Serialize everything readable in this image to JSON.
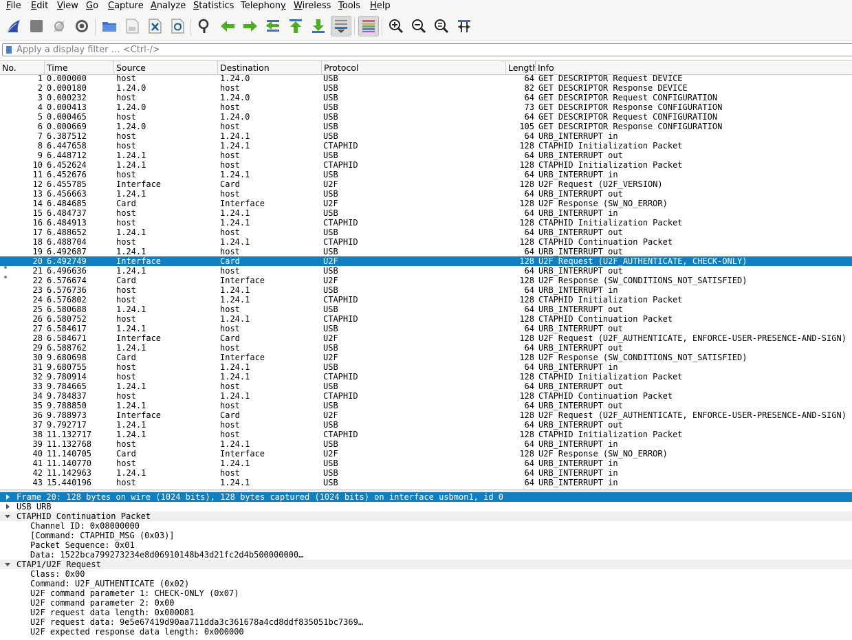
{
  "menu": [
    {
      "key": "file",
      "pre": "",
      "u": "F",
      "post": "ile"
    },
    {
      "key": "edit",
      "pre": "",
      "u": "E",
      "post": "dit"
    },
    {
      "key": "view",
      "pre": "",
      "u": "V",
      "post": "iew"
    },
    {
      "key": "go",
      "pre": "",
      "u": "G",
      "post": "o"
    },
    {
      "key": "capture",
      "pre": "",
      "u": "C",
      "post": "apture"
    },
    {
      "key": "analyze",
      "pre": "",
      "u": "A",
      "post": "nalyze"
    },
    {
      "key": "statistics",
      "pre": "",
      "u": "S",
      "post": "tatistics"
    },
    {
      "key": "telephony",
      "pre": "Telephon",
      "u": "y",
      "post": ""
    },
    {
      "key": "wireless",
      "pre": "",
      "u": "W",
      "post": "ireless"
    },
    {
      "key": "tools",
      "pre": "",
      "u": "T",
      "post": "ools"
    },
    {
      "key": "help",
      "pre": "",
      "u": "H",
      "post": "elp"
    }
  ],
  "toolbar_icons": [
    "shark-fin-icon",
    "stop-capture-icon",
    "restart-capture-icon",
    "capture-options-icon",
    "open-file-icon",
    "save-file-icon",
    "close-file-icon",
    "reload-file-icon",
    "find-packet-icon",
    "go-back-icon",
    "go-forward-icon",
    "go-to-packet-icon",
    "go-first-packet-icon",
    "go-last-packet-icon",
    "auto-scroll-icon",
    "colorize-icon",
    "zoom-in-icon",
    "zoom-out-icon",
    "zoom-normal-icon",
    "resize-columns-icon"
  ],
  "filter": {
    "placeholder": "Apply a display filter … <Ctrl-/>"
  },
  "columns": {
    "no": "No.",
    "time": "Time",
    "source": "Source",
    "destination": "Destination",
    "protocol": "Protocol",
    "length": "Length",
    "info": "Info"
  },
  "packets": [
    {
      "no": "1",
      "time": "0.000000",
      "src": "host",
      "dst": "1.24.0",
      "proto": "USB",
      "len": "64",
      "info": "GET DESCRIPTOR Request DEVICE"
    },
    {
      "no": "2",
      "time": "0.000180",
      "src": "1.24.0",
      "dst": "host",
      "proto": "USB",
      "len": "82",
      "info": "GET DESCRIPTOR Response DEVICE"
    },
    {
      "no": "3",
      "time": "0.000232",
      "src": "host",
      "dst": "1.24.0",
      "proto": "USB",
      "len": "64",
      "info": "GET DESCRIPTOR Request CONFIGURATION"
    },
    {
      "no": "4",
      "time": "0.000413",
      "src": "1.24.0",
      "dst": "host",
      "proto": "USB",
      "len": "73",
      "info": "GET DESCRIPTOR Response CONFIGURATION"
    },
    {
      "no": "5",
      "time": "0.000465",
      "src": "host",
      "dst": "1.24.0",
      "proto": "USB",
      "len": "64",
      "info": "GET DESCRIPTOR Request CONFIGURATION"
    },
    {
      "no": "6",
      "time": "0.000669",
      "src": "1.24.0",
      "dst": "host",
      "proto": "USB",
      "len": "105",
      "info": "GET DESCRIPTOR Response CONFIGURATION"
    },
    {
      "no": "7",
      "time": "6.387512",
      "src": "host",
      "dst": "1.24.1",
      "proto": "USB",
      "len": "64",
      "info": "URB_INTERRUPT in"
    },
    {
      "no": "8",
      "time": "6.447658",
      "src": "host",
      "dst": "1.24.1",
      "proto": "CTAPHID",
      "len": "128",
      "info": "CTAPHID Initialization Packet"
    },
    {
      "no": "9",
      "time": "6.448712",
      "src": "1.24.1",
      "dst": "host",
      "proto": "USB",
      "len": "64",
      "info": "URB_INTERRUPT out"
    },
    {
      "no": "10",
      "time": "6.452624",
      "src": "1.24.1",
      "dst": "host",
      "proto": "CTAPHID",
      "len": "128",
      "info": "CTAPHID Initialization Packet"
    },
    {
      "no": "11",
      "time": "6.452676",
      "src": "host",
      "dst": "1.24.1",
      "proto": "USB",
      "len": "64",
      "info": "URB_INTERRUPT in"
    },
    {
      "no": "12",
      "time": "6.455785",
      "src": "Interface",
      "dst": "Card",
      "proto": "U2F",
      "len": "128",
      "info": "U2F Request (U2F_VERSION)"
    },
    {
      "no": "13",
      "time": "6.456663",
      "src": "1.24.1",
      "dst": "host",
      "proto": "USB",
      "len": "64",
      "info": "URB_INTERRUPT out"
    },
    {
      "no": "14",
      "time": "6.484685",
      "src": "Card",
      "dst": "Interface",
      "proto": "U2F",
      "len": "128",
      "info": "U2F Response (SW_NO_ERROR)"
    },
    {
      "no": "15",
      "time": "6.484737",
      "src": "host",
      "dst": "1.24.1",
      "proto": "USB",
      "len": "64",
      "info": "URB_INTERRUPT in"
    },
    {
      "no": "16",
      "time": "6.484913",
      "src": "host",
      "dst": "1.24.1",
      "proto": "CTAPHID",
      "len": "128",
      "info": "CTAPHID Initialization Packet"
    },
    {
      "no": "17",
      "time": "6.488652",
      "src": "1.24.1",
      "dst": "host",
      "proto": "USB",
      "len": "64",
      "info": "URB_INTERRUPT out"
    },
    {
      "no": "18",
      "time": "6.488704",
      "src": "host",
      "dst": "1.24.1",
      "proto": "CTAPHID",
      "len": "128",
      "info": "CTAPHID Continuation Packet"
    },
    {
      "no": "19",
      "time": "6.492687",
      "src": "1.24.1",
      "dst": "host",
      "proto": "USB",
      "len": "64",
      "info": "URB_INTERRUPT out"
    },
    {
      "no": "20",
      "time": "6.492749",
      "src": "Interface",
      "dst": "Card",
      "proto": "U2F",
      "len": "128",
      "info": "U2F Request (U2F_AUTHENTICATE, CHECK-ONLY)",
      "selected": true
    },
    {
      "no": "21",
      "time": "6.496636",
      "src": "1.24.1",
      "dst": "host",
      "proto": "USB",
      "len": "64",
      "info": "URB_INTERRUPT out",
      "marked": true
    },
    {
      "no": "22",
      "time": "6.576674",
      "src": "Card",
      "dst": "Interface",
      "proto": "U2F",
      "len": "128",
      "info": "U2F Response (SW_CONDITIONS_NOT_SATISFIED)",
      "marked": true
    },
    {
      "no": "23",
      "time": "6.576736",
      "src": "host",
      "dst": "1.24.1",
      "proto": "USB",
      "len": "64",
      "info": "URB_INTERRUPT in"
    },
    {
      "no": "24",
      "time": "6.576802",
      "src": "host",
      "dst": "1.24.1",
      "proto": "CTAPHID",
      "len": "128",
      "info": "CTAPHID Initialization Packet"
    },
    {
      "no": "25",
      "time": "6.580688",
      "src": "1.24.1",
      "dst": "host",
      "proto": "USB",
      "len": "64",
      "info": "URB_INTERRUPT out"
    },
    {
      "no": "26",
      "time": "6.580752",
      "src": "host",
      "dst": "1.24.1",
      "proto": "CTAPHID",
      "len": "128",
      "info": "CTAPHID Continuation Packet"
    },
    {
      "no": "27",
      "time": "6.584617",
      "src": "1.24.1",
      "dst": "host",
      "proto": "USB",
      "len": "64",
      "info": "URB_INTERRUPT out"
    },
    {
      "no": "28",
      "time": "6.584671",
      "src": "Interface",
      "dst": "Card",
      "proto": "U2F",
      "len": "128",
      "info": "U2F Request (U2F_AUTHENTICATE, ENFORCE-USER-PRESENCE-AND-SIGN)"
    },
    {
      "no": "29",
      "time": "6.588762",
      "src": "1.24.1",
      "dst": "host",
      "proto": "USB",
      "len": "64",
      "info": "URB_INTERRUPT out"
    },
    {
      "no": "30",
      "time": "9.680698",
      "src": "Card",
      "dst": "Interface",
      "proto": "U2F",
      "len": "128",
      "info": "U2F Response (SW_CONDITIONS_NOT_SATISFIED)"
    },
    {
      "no": "31",
      "time": "9.680755",
      "src": "host",
      "dst": "1.24.1",
      "proto": "USB",
      "len": "64",
      "info": "URB_INTERRUPT in"
    },
    {
      "no": "32",
      "time": "9.780914",
      "src": "host",
      "dst": "1.24.1",
      "proto": "CTAPHID",
      "len": "128",
      "info": "CTAPHID Initialization Packet"
    },
    {
      "no": "33",
      "time": "9.784665",
      "src": "1.24.1",
      "dst": "host",
      "proto": "USB",
      "len": "64",
      "info": "URB_INTERRUPT out"
    },
    {
      "no": "34",
      "time": "9.784837",
      "src": "host",
      "dst": "1.24.1",
      "proto": "CTAPHID",
      "len": "128",
      "info": "CTAPHID Continuation Packet"
    },
    {
      "no": "35",
      "time": "9.788850",
      "src": "1.24.1",
      "dst": "host",
      "proto": "USB",
      "len": "64",
      "info": "URB_INTERRUPT out"
    },
    {
      "no": "36",
      "time": "9.788973",
      "src": "Interface",
      "dst": "Card",
      "proto": "U2F",
      "len": "128",
      "info": "U2F Request (U2F_AUTHENTICATE, ENFORCE-USER-PRESENCE-AND-SIGN)"
    },
    {
      "no": "37",
      "time": "9.792717",
      "src": "1.24.1",
      "dst": "host",
      "proto": "USB",
      "len": "64",
      "info": "URB_INTERRUPT out"
    },
    {
      "no": "38",
      "time": "11.132717",
      "src": "1.24.1",
      "dst": "host",
      "proto": "CTAPHID",
      "len": "128",
      "info": "CTAPHID Initialization Packet"
    },
    {
      "no": "39",
      "time": "11.132768",
      "src": "host",
      "dst": "1.24.1",
      "proto": "USB",
      "len": "64",
      "info": "URB_INTERRUPT in"
    },
    {
      "no": "40",
      "time": "11.140705",
      "src": "Card",
      "dst": "Interface",
      "proto": "U2F",
      "len": "128",
      "info": "U2F Response (SW_NO_ERROR)"
    },
    {
      "no": "41",
      "time": "11.140770",
      "src": "host",
      "dst": "1.24.1",
      "proto": "USB",
      "len": "64",
      "info": "URB_INTERRUPT in"
    },
    {
      "no": "42",
      "time": "11.142963",
      "src": "1.24.1",
      "dst": "host",
      "proto": "USB",
      "len": "64",
      "info": "URB_INTERRUPT in"
    },
    {
      "no": "43",
      "time": "15.440196",
      "src": "host",
      "dst": "1.24.1",
      "proto": "USB",
      "len": "64",
      "info": "URB_INTERRUPT in"
    }
  ],
  "details": [
    {
      "text": "Frame 20: 128 bytes on wire (1024 bits), 128 bytes captured (1024 bits) on interface usbmon1, id 0",
      "level": 0,
      "arrow": "right",
      "selected": true
    },
    {
      "text": "USB URB",
      "level": 0,
      "arrow": "right"
    },
    {
      "text": "CTAPHID Continuation Packet",
      "level": 0,
      "arrow": "down",
      "header": true
    },
    {
      "text": "Channel ID: 0x08000000",
      "level": 1
    },
    {
      "text": "[Command: CTAPHID_MSG (0x03)]",
      "level": 1
    },
    {
      "text": "Packet Sequence: 0x01",
      "level": 1
    },
    {
      "text": "Data: 1522bca799273234e8d06910148b43d21fc2d4b500000000…",
      "level": 1
    },
    {
      "text": "CTAP1/U2F Request",
      "level": 0,
      "arrow": "down",
      "header": true
    },
    {
      "text": "Class: 0x00",
      "level": 1
    },
    {
      "text": "Command: U2F_AUTHENTICATE (0x02)",
      "level": 1
    },
    {
      "text": "U2F command parameter 1: CHECK-ONLY (0x07)",
      "level": 1
    },
    {
      "text": "U2F command parameter 2: 0x00",
      "level": 1
    },
    {
      "text": "U2F request data length: 0x000081",
      "level": 1
    },
    {
      "text": "U2F request data: 9e5e67419d90aa711dda3c361678a4cd8ddf835051bc7369…",
      "level": 1
    },
    {
      "text": "U2F expected response data length: 0x000000",
      "level": 1
    }
  ],
  "colors": {
    "selection": "#0f7fc2",
    "toolbar_bg": "#f6f6f5",
    "arrow_green": "#4caf1e",
    "file_blue": "#3b6fc2"
  }
}
